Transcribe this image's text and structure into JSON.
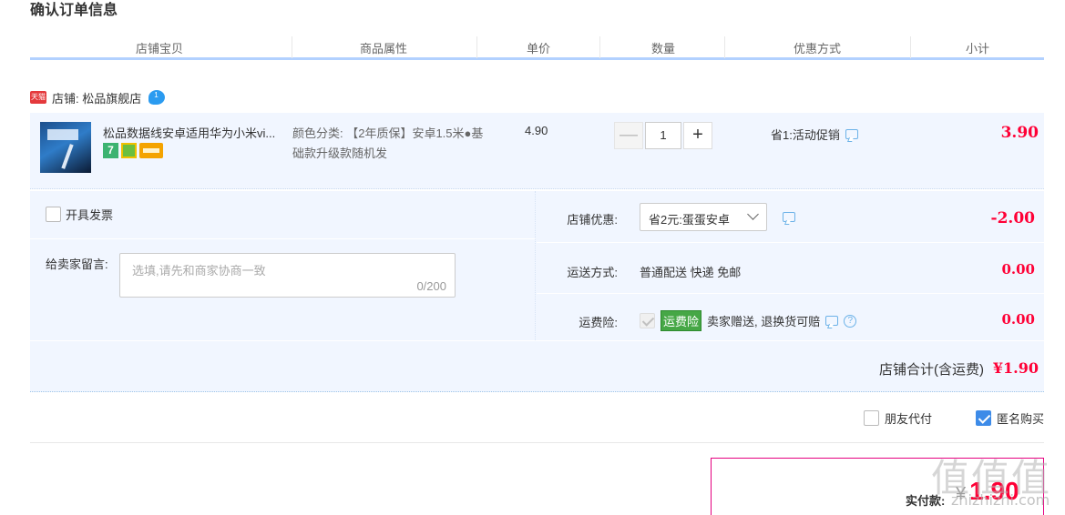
{
  "page_title": "确认订单信息",
  "columns": {
    "shop_item": "店铺宝贝",
    "attributes": "商品属性",
    "unit_price": "单价",
    "quantity": "数量",
    "promotion": "优惠方式",
    "subtotal": "小计"
  },
  "shop": {
    "badge": "天猫",
    "label": "店铺: 松品旗舰店"
  },
  "item": {
    "title": "松品数据线安卓适用华为小米vi...",
    "badge_7": "7",
    "attributes": "颜色分类: 【2年质保】安卓1.5米●基础款升级款随机发",
    "price": "4.90",
    "quantity": "1",
    "minus": "—",
    "plus": "+",
    "promotion": "省1:活动促销",
    "subtotal": "3.90"
  },
  "invoice": {
    "label": "开具发票"
  },
  "message": {
    "label": "给卖家留言:",
    "placeholder": "选填,请先和商家协商一致",
    "counter": "0/200"
  },
  "shop_discount": {
    "label": "店铺优惠:",
    "selected": "省2元:蛋蛋安卓",
    "amount": "-2.00"
  },
  "shipping": {
    "label": "运送方式:",
    "value": "普通配送 快递 免邮",
    "amount": "0.00"
  },
  "insurance": {
    "label": "运费险:",
    "tag": "运费险",
    "text": "卖家赠送, 退换货可赔",
    "help": "?",
    "amount": "0.00"
  },
  "shop_total": {
    "label": "店铺合计(含运费)",
    "amount": "¥1.90"
  },
  "options": {
    "friend_pay": "朋友代付",
    "anonymous": "匿名购买"
  },
  "payment": {
    "label": "实付款:",
    "currency": "¥",
    "amount": "1.90"
  },
  "watermark": {
    "main": "值值值",
    "sub": "zhizhizhi.com"
  }
}
